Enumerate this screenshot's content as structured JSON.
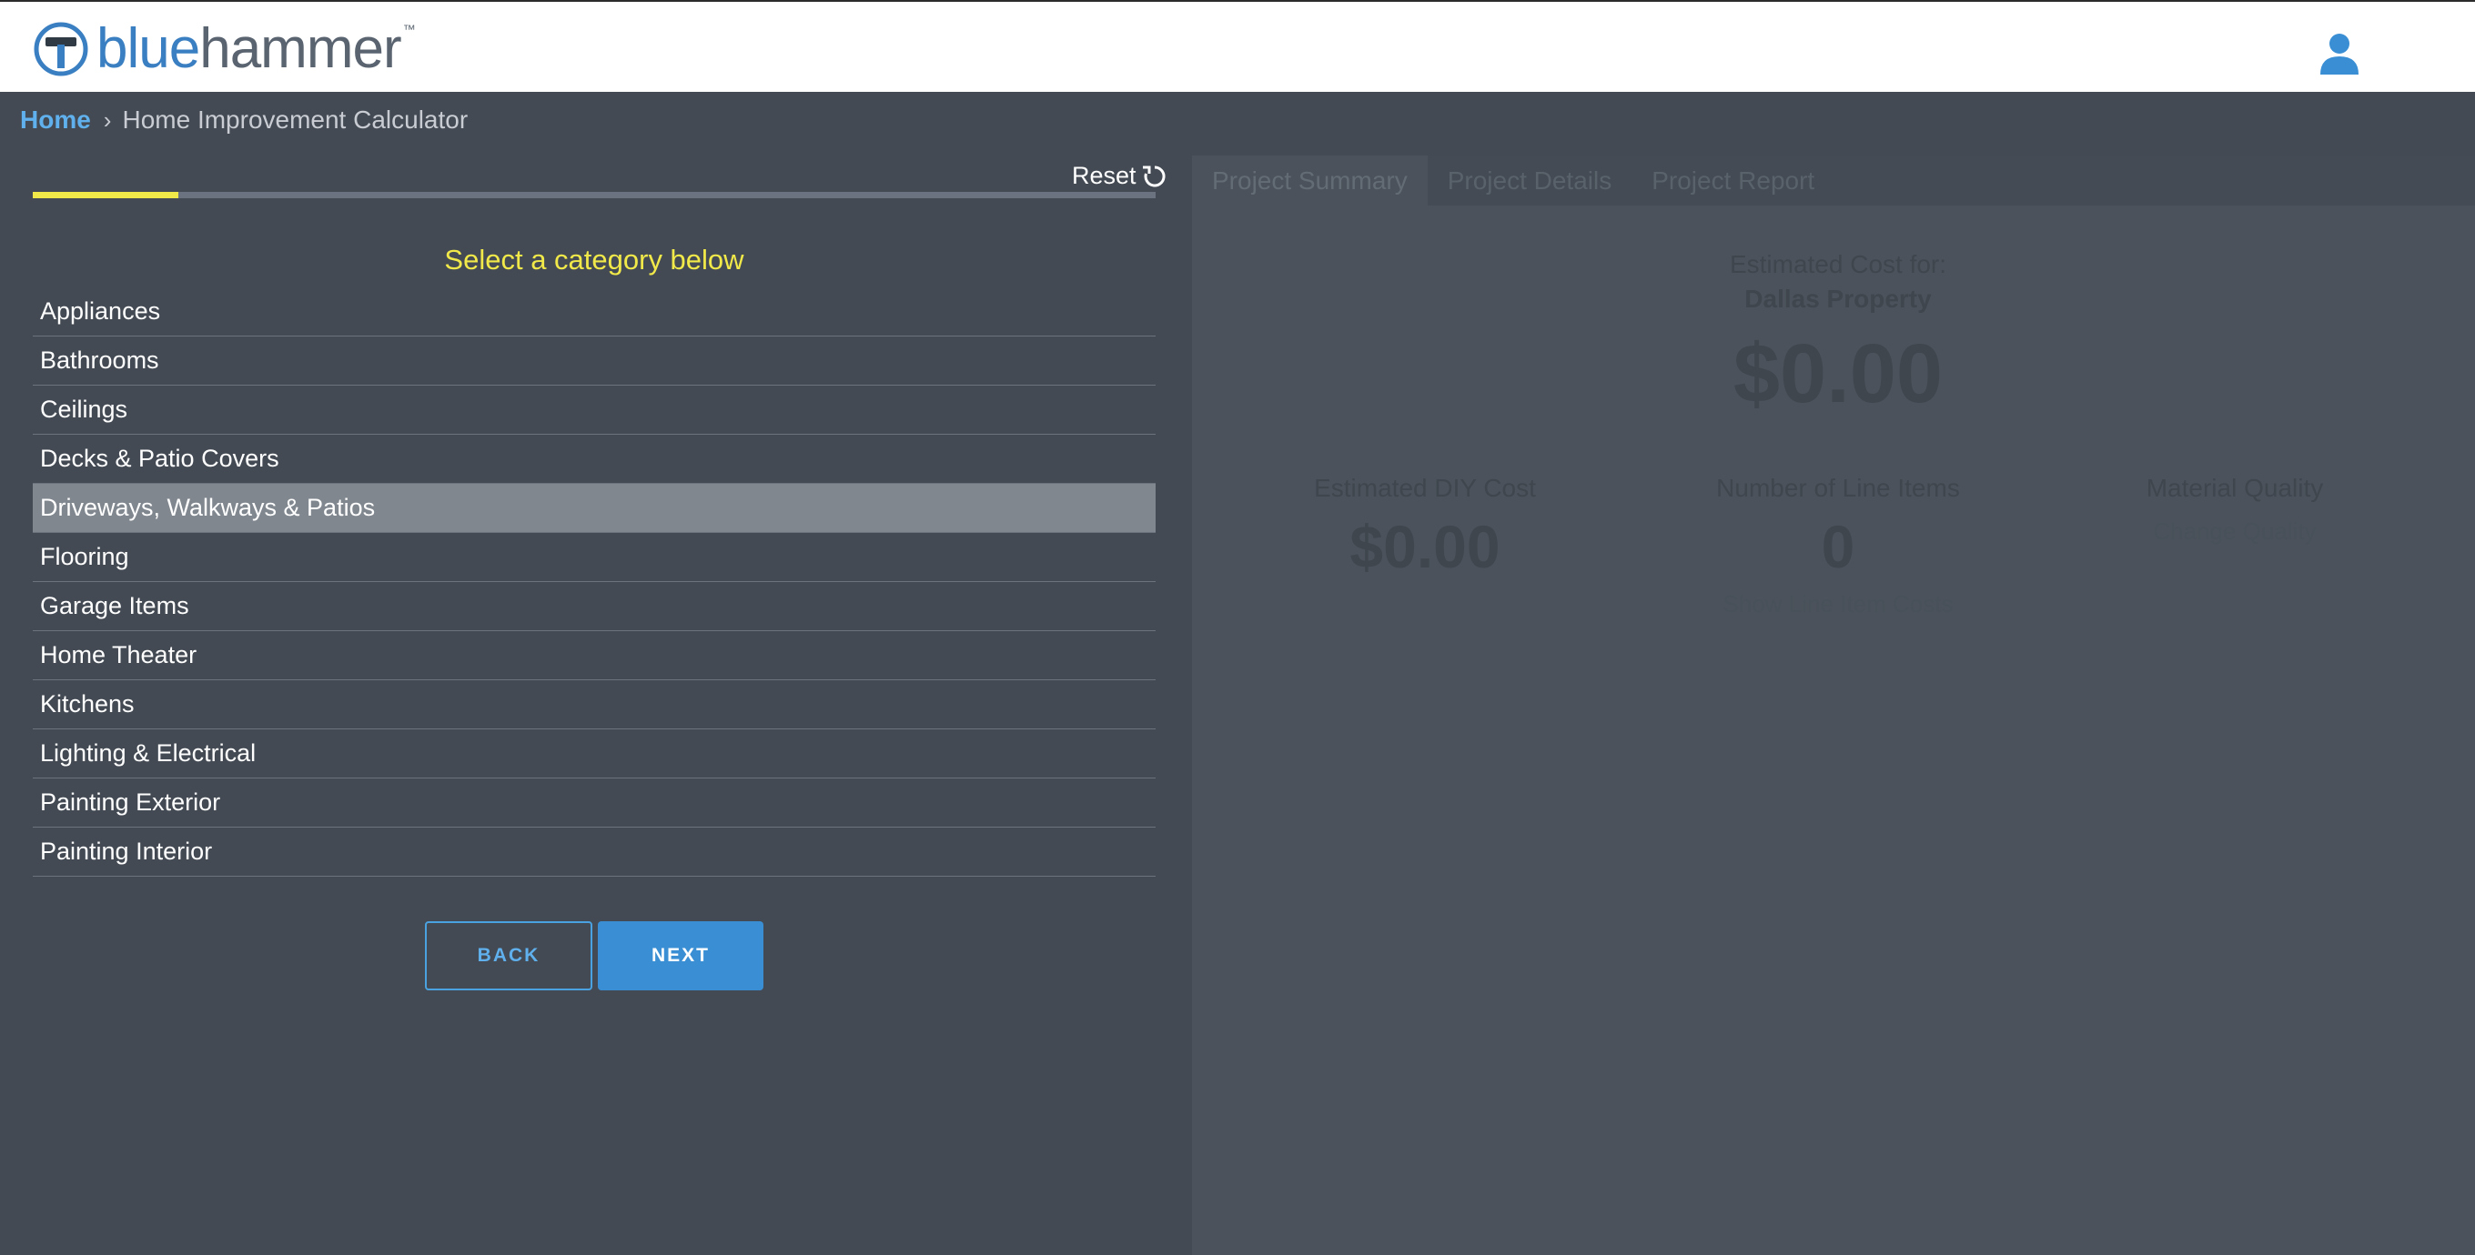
{
  "header": {
    "logo_blue": "blue",
    "logo_gray": "hammer",
    "logo_tm": "™",
    "user_icon": "user-icon",
    "colors": {
      "brand_blue": "#3a7fc1",
      "logo_gray": "#5a6470"
    }
  },
  "breadcrumb": {
    "home": "Home",
    "separator": "›",
    "current": "Home Improvement Calculator"
  },
  "wizard": {
    "reset_label": "Reset",
    "progress_fraction": 0.13,
    "prompt": "Select a category below",
    "categories": [
      "Appliances",
      "Bathrooms",
      "Ceilings",
      "Decks & Patio Covers",
      "Driveways, Walkways & Patios",
      "Flooring",
      "Garage Items",
      "Home Theater",
      "Kitchens",
      "Lighting & Electrical",
      "Painting Exterior",
      "Painting Interior"
    ],
    "selected_category": "Driveways, Walkways & Patios",
    "back_label": "BACK",
    "next_label": "NEXT",
    "colors": {
      "accent_yellow": "#f1e94a",
      "button_blue": "#3a8fd4"
    }
  },
  "summary": {
    "tabs": [
      "Project Summary",
      "Project Details",
      "Project Report"
    ],
    "active_tab": "Project Summary",
    "estimated_cost_label": "Estimated Cost for:",
    "property_name": "Dallas Property",
    "total_cost": "$0.00",
    "diy_label": "Estimated DIY Cost",
    "diy_value": "$0.00",
    "line_items_label": "Number of Line Items",
    "line_items_value": "0",
    "line_items_link": "Show Line Item Costs",
    "quality_label": "Material Quality",
    "quality_link": "Change Quality"
  }
}
